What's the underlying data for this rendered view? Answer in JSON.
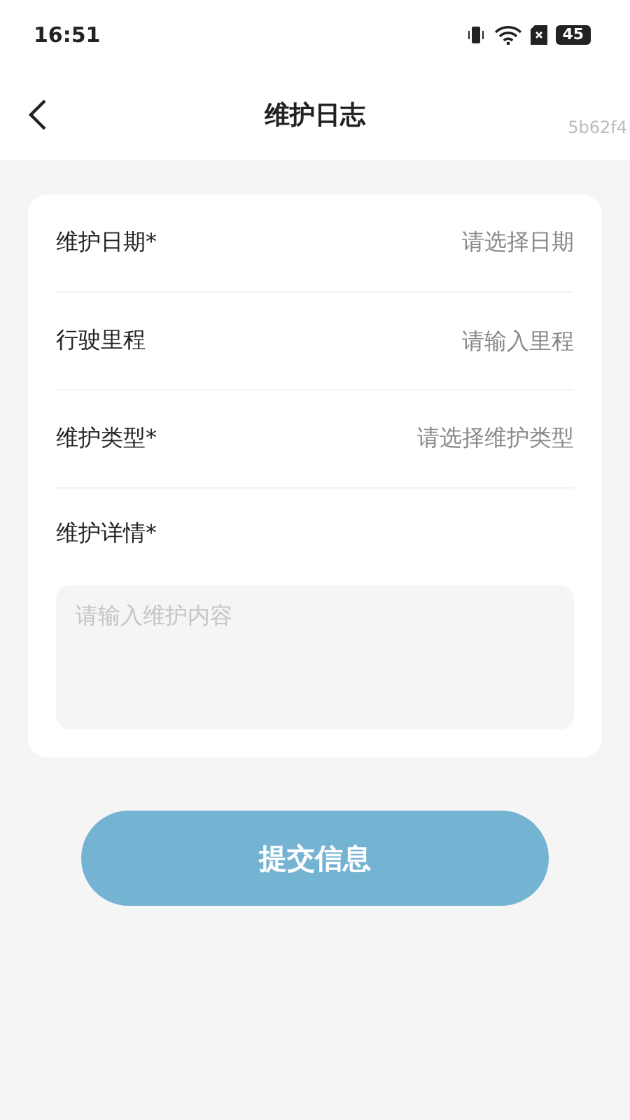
{
  "status_bar": {
    "time": "16:51",
    "battery": "45"
  },
  "header": {
    "title": "维护日志",
    "tag": "5b62f4"
  },
  "form": {
    "fields": [
      {
        "label": "维护日期*",
        "kind": "select",
        "placeholder": "请选择日期"
      },
      {
        "label": "行驶里程",
        "kind": "input",
        "placeholder": "请输入里程"
      },
      {
        "label": "维护类型*",
        "kind": "select",
        "placeholder": "请选择维护类型"
      },
      {
        "label": "维护详情*",
        "kind": "textarea",
        "placeholder": "请输入维护内容"
      }
    ]
  },
  "submit_button": "提交信息"
}
